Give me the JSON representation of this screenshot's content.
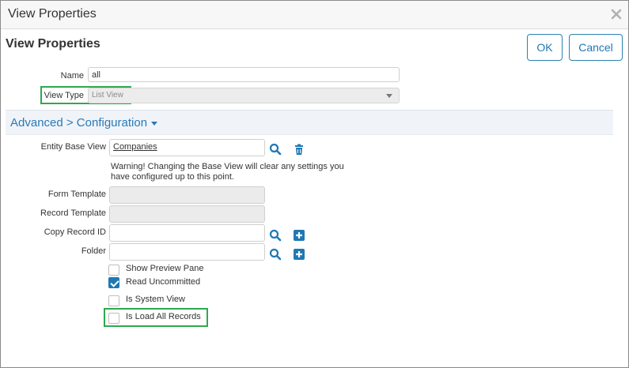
{
  "window": {
    "title": "View Properties"
  },
  "header": {
    "title": "View Properties",
    "ok_label": "OK",
    "cancel_label": "Cancel"
  },
  "form": {
    "name": {
      "label": "Name",
      "value": "all"
    },
    "view_type": {
      "label": "View Type",
      "value": "List View"
    }
  },
  "advanced": {
    "title": "Advanced > Configuration"
  },
  "config": {
    "entity_base_view": {
      "label": "Entity Base View",
      "value": "Companies"
    },
    "warning": "Warning! Changing the Base View will clear any settings you have configured up to this point.",
    "form_template": {
      "label": "Form Template",
      "value": ""
    },
    "record_template": {
      "label": "Record Template",
      "value": ""
    },
    "copy_record_id": {
      "label": "Copy Record ID",
      "value": ""
    },
    "folder": {
      "label": "Folder",
      "value": ""
    }
  },
  "checkboxes": [
    {
      "label": "Show Preview Pane",
      "checked": false
    },
    {
      "label": "Read Uncommitted",
      "checked": true
    },
    {
      "label": "Is System View",
      "checked": false
    },
    {
      "label": "Is Load All Records",
      "checked": false
    }
  ],
  "colors": {
    "accent": "#1f78b4",
    "highlight": "#2fa84f",
    "link": "#2a7ab7"
  }
}
